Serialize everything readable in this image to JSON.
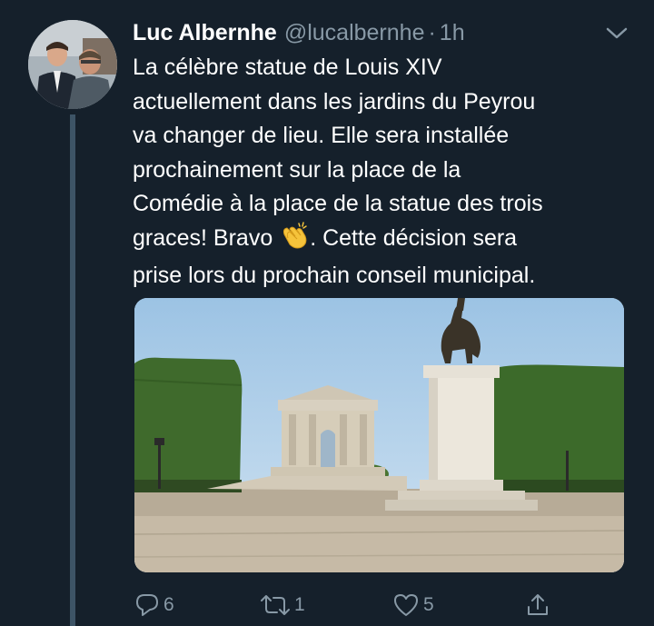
{
  "tweet": {
    "author_name": "Luc Albernhe",
    "handle": "@lucalbernhe",
    "separator": "·",
    "time": "1h",
    "text_lines": [
      "La célèbre statue de Louis XIV",
      "actuellement dans les jardins du Peyrou",
      "va changer de lieu. Elle sera installée",
      "prochainement sur la place de la",
      "Comédie à la place de la statue des trois"
    ],
    "text_line6_before": "graces! Bravo ",
    "text_line6_after": ". Cette décision sera",
    "text_line7": "prise lors du prochain conseil municipal.",
    "emoji": "clapping-hands-emoji"
  },
  "actions": {
    "reply_count": "6",
    "retweet_count": "1",
    "like_count": "5"
  },
  "icons": {
    "reply": "reply-icon",
    "retweet": "retweet-icon",
    "like": "heart-icon",
    "share": "share-icon",
    "more": "chevron-down-icon"
  },
  "colors": {
    "background": "#15202b",
    "text": "#ffffff",
    "muted": "#8899a6",
    "thread_line": "#3d5466"
  }
}
